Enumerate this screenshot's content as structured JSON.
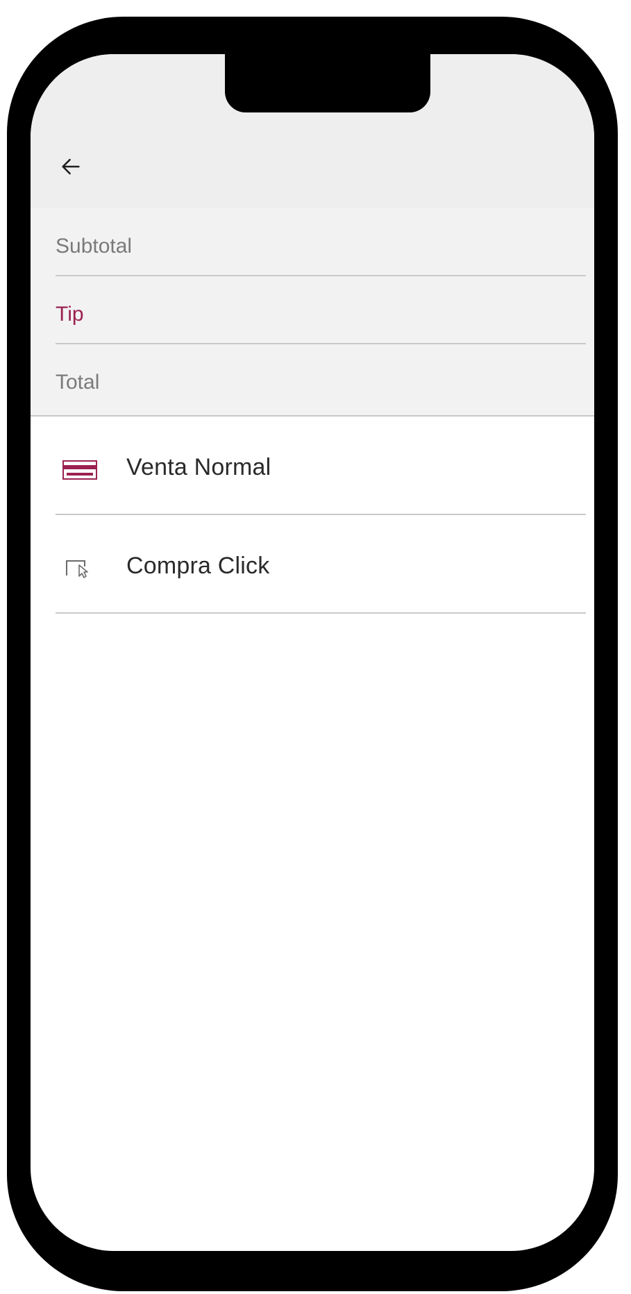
{
  "header": {
    "back_icon": "arrow-left-icon"
  },
  "amounts": {
    "subtotal_label": "Subtotal",
    "tip_label": "Tip",
    "total_label": "Total"
  },
  "options": [
    {
      "label": "Venta Normal",
      "icon": "card-icon"
    },
    {
      "label": "Compra Click",
      "icon": "cursor-click-icon"
    }
  ],
  "colors": {
    "accent": "#9b2150",
    "app_bar_bg": "#eeeeee",
    "field_bg": "#f2f2f2"
  }
}
